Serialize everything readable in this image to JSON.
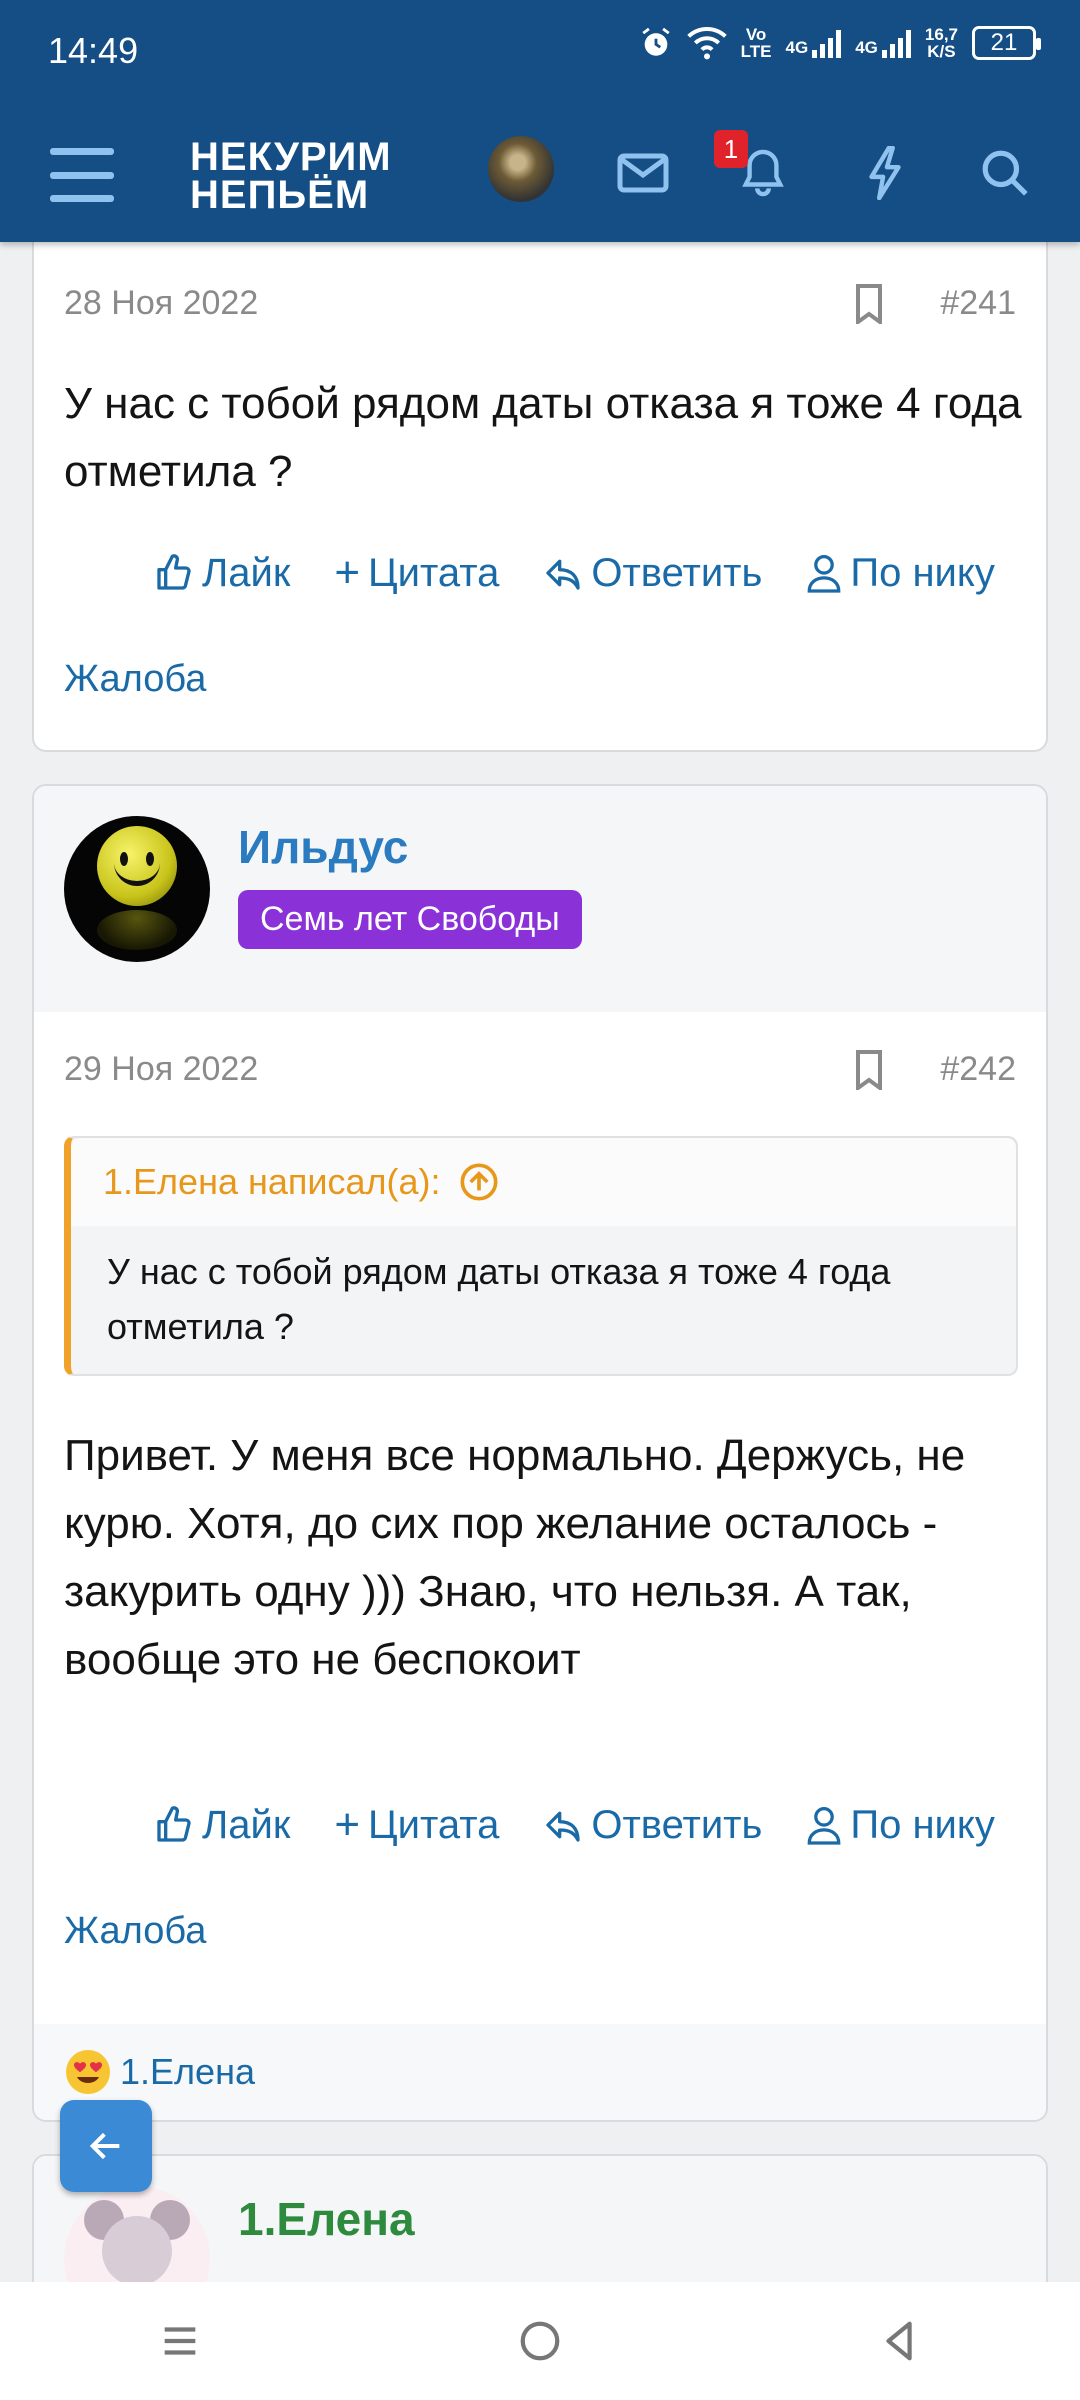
{
  "status_bar": {
    "time": "14:49",
    "net_speed_top": "16,7",
    "net_speed_bottom": "K/S",
    "battery": "21",
    "volte_top": "Vo",
    "volte_bottom": "LTE",
    "net1": "4G",
    "net2": "4G"
  },
  "header": {
    "logo_line1": "НЕКУРИМ",
    "logo_line2": "НЕПЬЁМ",
    "notification_count": "1"
  },
  "posts": [
    {
      "date": "28 Ноя 2022",
      "number": "#241",
      "text": "У нас с тобой рядом даты отказа я тоже 4 года отметила ?",
      "actions": {
        "like": "Лайк",
        "quote": "Цитата",
        "reply": "Ответить",
        "by_nick": "По нику"
      },
      "report": "Жалоба"
    },
    {
      "author": "Ильдус",
      "rank": "Семь лет Свободы",
      "date": "29 Ноя 2022",
      "number": "#242",
      "quote_author": "1.Елена написал(а):",
      "quote_text": "У нас с тобой рядом даты отказа я тоже 4 года отметила ?",
      "text": "Привет. У меня все нормально. Держусь, не курю. Хотя, до сих пор желание осталось - закурить одну ))) Знаю, что нельзя. А так, вообще это не беспокоит",
      "actions": {
        "like": "Лайк",
        "quote": "Цитата",
        "reply": "Ответить",
        "by_nick": "По нику"
      },
      "report": "Жалоба",
      "reaction_user": "1.Елена"
    },
    {
      "author": "1.Елена"
    }
  ],
  "colors": {
    "header_bg": "#144e84",
    "link": "#1a6aa8",
    "rank_bg": "#8a31d8",
    "quote_accent": "#f0a12a",
    "author_green": "#2e8b3e"
  }
}
